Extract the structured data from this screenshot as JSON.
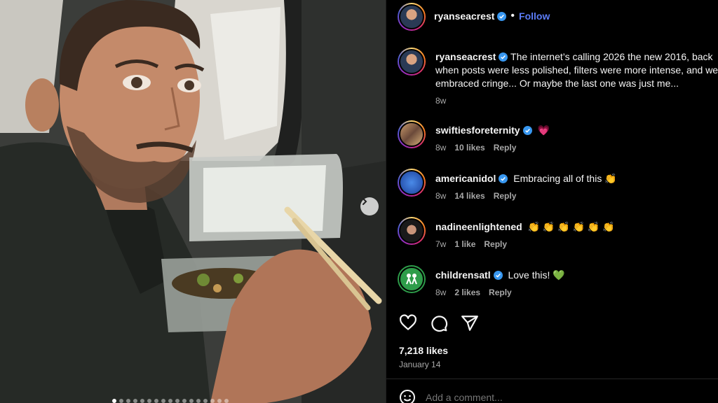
{
  "post": {
    "author": "ryanseacrest",
    "follow_label": "Follow",
    "separator": "•",
    "caption_lines": [
      "The internet’s calling 2026 the new 2016, back",
      "when posts were less polished, filters were more intense, and we",
      "embraced cringe... Or maybe the last one was just me..."
    ],
    "caption_time": "8w",
    "likes": "7,218 likes",
    "date": "January 14"
  },
  "comments": [
    {
      "user": "swiftiesforeternity",
      "text": "💗",
      "time": "8w",
      "likes": "10 likes",
      "reply": "Reply"
    },
    {
      "user": "americanidol",
      "text": "Embracing all of this 👏",
      "time": "8w",
      "likes": "14 likes",
      "reply": "Reply"
    },
    {
      "user": "nadineenlightened",
      "text": "👏 👏 👏 👏 👏 👏",
      "time": "7w",
      "likes": "1 like",
      "reply": "Reply"
    },
    {
      "user": "childrensatl",
      "text": "Love this! 💚",
      "time": "8w",
      "likes": "2 likes",
      "reply": "Reply"
    }
  ],
  "comment_box": {
    "placeholder": "Add a comment..."
  },
  "icons": {
    "like": "heart-icon",
    "comment": "comment-icon",
    "share": "share-icon",
    "emoji": "emoji-icon",
    "next": "chevron-right-icon",
    "verified": "verified-badge-icon"
  },
  "colors": {
    "accent": "#5b7cf6",
    "background": "#000000",
    "muted": "#a8a8a8"
  }
}
